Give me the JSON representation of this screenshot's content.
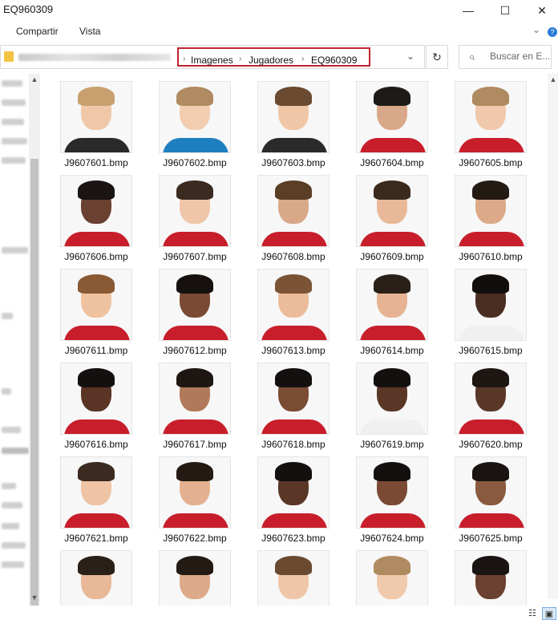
{
  "window": {
    "title": "EQ960309"
  },
  "controls": {
    "minimize": "—",
    "maximize": "☐",
    "close": "✕"
  },
  "ribbon": {
    "tabs": [
      "Compartir",
      "Vista"
    ],
    "expand_icon": "chevron-down-icon",
    "help_icon": "help-icon"
  },
  "address": {
    "crumbs": [
      "Imagenes",
      "Jugadores",
      "EQ960309"
    ],
    "separator": "›",
    "dropdown_icon": "⌄",
    "refresh_icon": "↻"
  },
  "search": {
    "placeholder": "Buscar en E...",
    "icon": "⌕"
  },
  "scroll": {
    "up": "▲",
    "down": "▼"
  },
  "status": {
    "details_view_icon": "☷",
    "large_icons_view_icon": "▣"
  },
  "files": [
    {
      "name": "J9607601.bmp",
      "skin": "#f0c8a8",
      "hair": "#c8a070",
      "shirt": "#2a2a2a"
    },
    {
      "name": "J9607602.bmp",
      "skin": "#f2cdb0",
      "hair": "#b08a60",
      "shirt": "#1e7fc0"
    },
    {
      "name": "J9607603.bmp",
      "skin": "#efc6a6",
      "hair": "#6a4a30",
      "shirt": "#2a2a2a"
    },
    {
      "name": "J9607604.bmp",
      "skin": "#d9a888",
      "hair": "#1e1a18",
      "shirt": "#c81e2c"
    },
    {
      "name": "J9607605.bmp",
      "skin": "#f0c8ac",
      "hair": "#b08a60",
      "shirt": "#c81e2c"
    },
    {
      "name": "J9607606.bmp",
      "skin": "#6a4030",
      "hair": "#1a1412",
      "shirt": "#c81e2c"
    },
    {
      "name": "J9607607.bmp",
      "skin": "#efc6a8",
      "hair": "#3a2a20",
      "shirt": "#c81e2c"
    },
    {
      "name": "J9607608.bmp",
      "skin": "#d8a888",
      "hair": "#5a3e26",
      "shirt": "#c81e2c"
    },
    {
      "name": "J9607609.bmp",
      "skin": "#e8b898",
      "hair": "#3a2a1e",
      "shirt": "#c81e2c"
    },
    {
      "name": "J9607610.bmp",
      "skin": "#dcaa88",
      "hair": "#241a14",
      "shirt": "#c81e2c"
    },
    {
      "name": "J9607611.bmp",
      "skin": "#efc2a0",
      "hair": "#8a5a34",
      "shirt": "#c81e2c"
    },
    {
      "name": "J9607612.bmp",
      "skin": "#7a4a34",
      "hair": "#16100e",
      "shirt": "#c81e2c"
    },
    {
      "name": "J9607613.bmp",
      "skin": "#ecbc9a",
      "hair": "#7a5434",
      "shirt": "#c81e2c"
    },
    {
      "name": "J9607614.bmp",
      "skin": "#e6b494",
      "hair": "#2a2018",
      "shirt": "#c81e2c"
    },
    {
      "name": "J9607615.bmp",
      "skin": "#4a2e22",
      "hair": "#120e0c",
      "shirt": "#f0f0f0"
    },
    {
      "name": "J9607616.bmp",
      "skin": "#5a3424",
      "hair": "#141010",
      "shirt": "#c81e2c"
    },
    {
      "name": "J9607617.bmp",
      "skin": "#b07a5a",
      "hair": "#1e1612",
      "shirt": "#c81e2c"
    },
    {
      "name": "J9607618.bmp",
      "skin": "#7a4c34",
      "hair": "#141010",
      "shirt": "#c81e2c"
    },
    {
      "name": "J9607619.bmp",
      "skin": "#5a3626",
      "hair": "#141010",
      "shirt": "#f0f0f0"
    },
    {
      "name": "J9607620.bmp",
      "skin": "#5a3828",
      "hair": "#1e1612",
      "shirt": "#c81e2c"
    },
    {
      "name": "J9607621.bmp",
      "skin": "#efc4a4",
      "hair": "#3a2a20",
      "shirt": "#c81e2c"
    },
    {
      "name": "J9607622.bmp",
      "skin": "#e4b090",
      "hair": "#241a14",
      "shirt": "#c81e2c"
    },
    {
      "name": "J9607623.bmp",
      "skin": "#5a3626",
      "hair": "#141010",
      "shirt": "#c81e2c"
    },
    {
      "name": "J9607624.bmp",
      "skin": "#7a4a34",
      "hair": "#141010",
      "shirt": "#c81e2c"
    },
    {
      "name": "J9607625.bmp",
      "skin": "#8a5a40",
      "hair": "#1a1412",
      "shirt": "#c81e2c"
    },
    {
      "name": "",
      "skin": "#e8b898",
      "hair": "#2a2018",
      "shirt": "#c81e2c"
    },
    {
      "name": "",
      "skin": "#dcaa88",
      "hair": "#241a14",
      "shirt": "#c81e2c"
    },
    {
      "name": "",
      "skin": "#efc6a8",
      "hair": "#6a4a30",
      "shirt": "#c81e2c"
    },
    {
      "name": "",
      "skin": "#f0caac",
      "hair": "#b08a60",
      "shirt": "#c81e2c"
    },
    {
      "name": "",
      "skin": "#6a4030",
      "hair": "#1a1412",
      "shirt": "#c81e2c"
    }
  ]
}
